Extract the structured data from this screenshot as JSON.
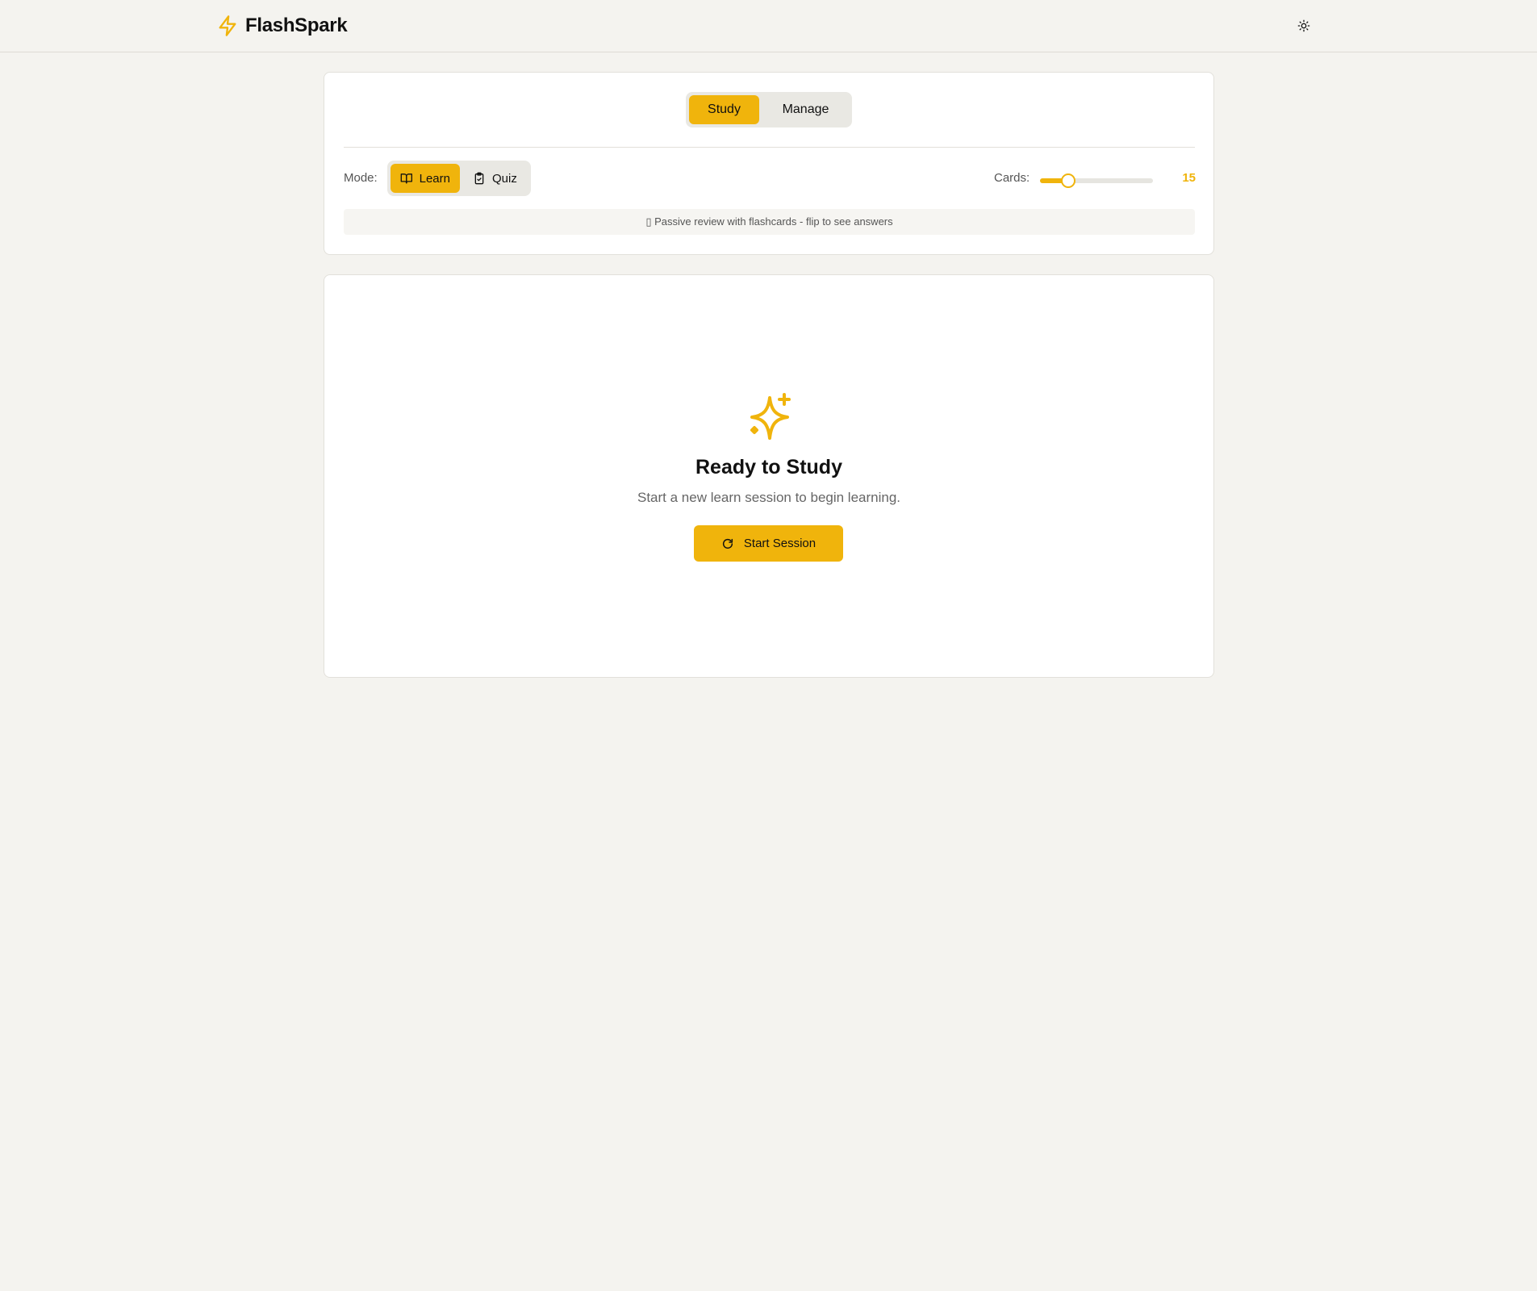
{
  "header": {
    "brand_title": "FlashSpark",
    "brand_icon": "lightning-bolt-icon",
    "theme_toggle_icon": "sun-icon"
  },
  "tabs": [
    {
      "label": "Study",
      "active": true
    },
    {
      "label": "Manage",
      "active": false
    }
  ],
  "mode": {
    "label": "Mode:",
    "options": [
      {
        "label": "Learn",
        "icon": "book-open-icon",
        "active": true
      },
      {
        "label": "Quiz",
        "icon": "clipboard-check-icon",
        "active": false
      }
    ]
  },
  "cards": {
    "label": "Cards:",
    "value": "15",
    "slider_fraction": 0.25
  },
  "hint": "▯ Passive review with flashcards - flip to see answers",
  "empty_state": {
    "icon": "sparkles-icon",
    "title": "Ready to Study",
    "subtitle": "Start a new learn session to begin learning.",
    "button_label": "Start Session",
    "button_icon": "refresh-icon"
  },
  "colors": {
    "accent": "#f0b40c",
    "background": "#f4f3ef"
  }
}
